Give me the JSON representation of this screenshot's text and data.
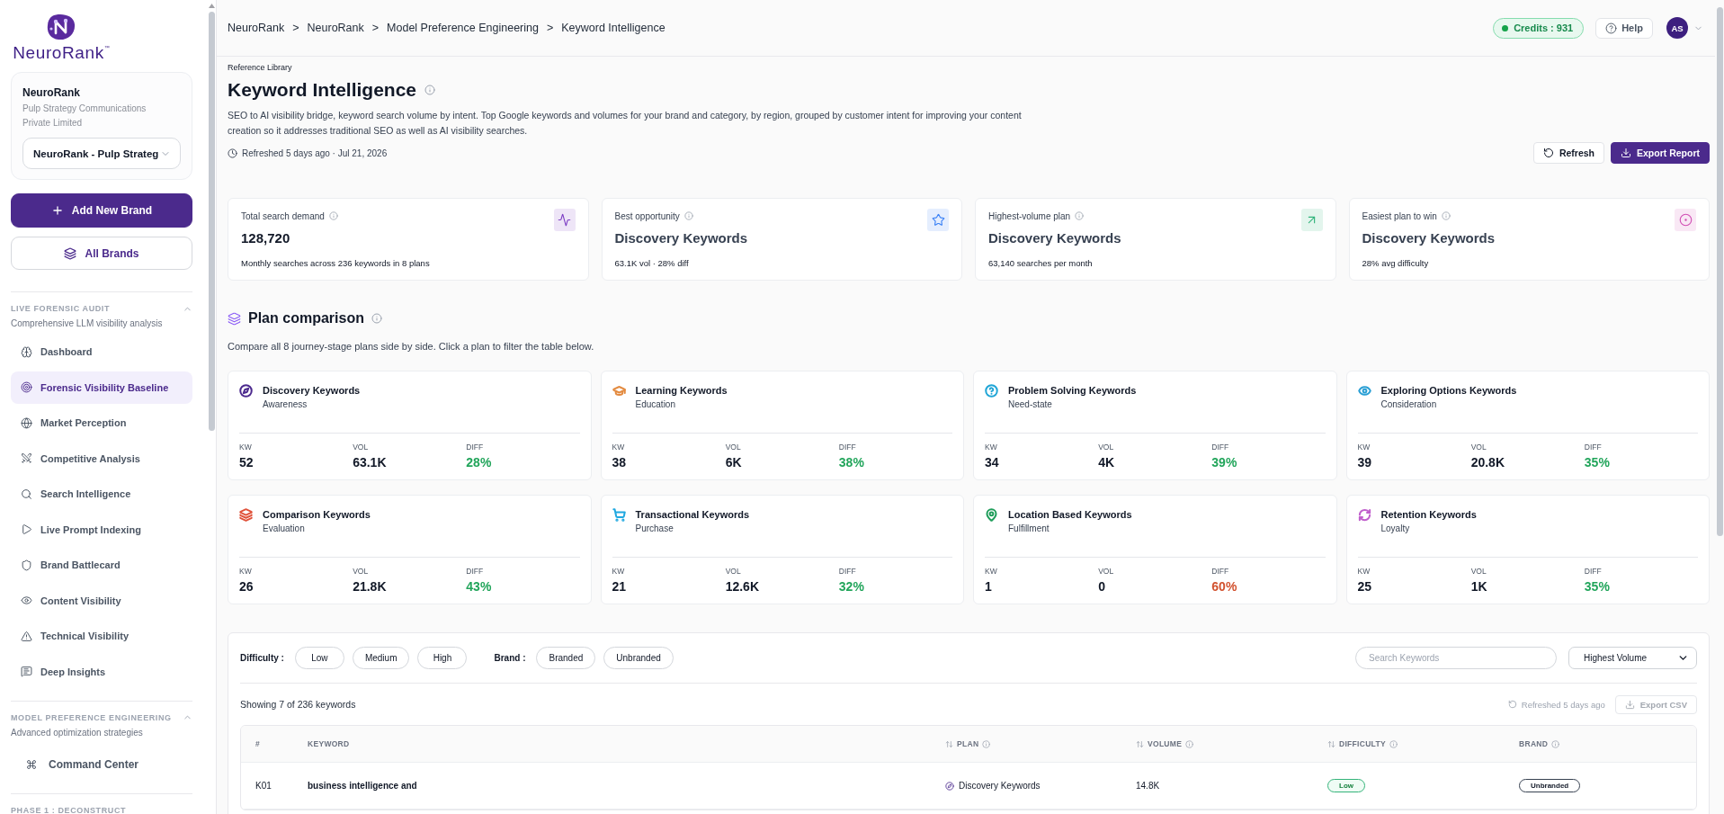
{
  "sidebar": {
    "logo": "NeuroRank$^{™}$",
    "brand": {
      "name": "NeuroRank",
      "company": "Pulp Strategy Communications Private Limited",
      "selector": "NeuroRank - Pulp Strateg"
    },
    "actions": [
      {
        "label": "Add New Brand",
        "kind": "primary"
      },
      {
        "label": "All Brands",
        "kind": "secondary"
      }
    ],
    "sections": [
      {
        "title": "LIVE FORENSIC AUDIT",
        "subtitle": "Comprehensive LLM visibility analysis",
        "expanded": true,
        "items": [
          {
            "label": "Dashboard",
            "selected": false,
            "kind": "page"
          },
          {
            "label": "Forensic Visibility Baseline",
            "selected": true,
            "kind": "page"
          },
          {
            "label": "Market Perception",
            "selected": false,
            "kind": "page"
          },
          {
            "label": "Competitive Analysis",
            "selected": false,
            "kind": "page"
          },
          {
            "label": "Search Intelligence",
            "selected": false,
            "kind": "page"
          },
          {
            "label": "Live Prompt Indexing",
            "selected": false,
            "kind": "page"
          },
          {
            "label": "Brand Battlecard",
            "selected": false,
            "kind": "page"
          },
          {
            "label": "Content Visibility",
            "selected": false,
            "kind": "page"
          },
          {
            "label": "Technical Visibility",
            "selected": false,
            "kind": "page"
          },
          {
            "label": "Deep Insights",
            "selected": false,
            "kind": "page"
          }
        ]
      },
      {
        "title": "MODEL PREFERENCE ENGINEERING",
        "subtitle": "Advanced optimization strategies",
        "expanded": true,
        "items": [
          {
            "label": "Command Center",
            "selected": false,
            "kind": "command"
          }
        ]
      },
      {
        "title": "PHASE 1 : DECONSTRUCT"
      }
    ]
  },
  "header": {
    "breadcrumb": [
      "NeuroRank",
      "NeuroRank",
      "Model Preference Engineering",
      "Keyword Intelligence"
    ],
    "separator": ">",
    "credits": "Credits : 931",
    "help": "Help",
    "avatar": "AS"
  },
  "page": {
    "eyebrow": "Reference Library",
    "title": "Keyword Intelligence",
    "description": "SEO to AI visibility bridge, keyword search volume by intent. Top Google keywords and volumes for your brand and category, by region, grouped by customer intent for improving your content creation so it addresses traditional SEO as well as AI visibility searches.",
    "refreshed": "Refreshed 5 days ago · Jul 21, 2026",
    "buttons": [
      {
        "label": "Refresh",
        "kind": "secondary"
      },
      {
        "label": "Export Report",
        "kind": "primary"
      }
    ]
  },
  "stats": [
    {
      "label": "Total search demand",
      "value": "128,720",
      "note": "Monthly searches across 236 keywords in 8 plans",
      "color": "#7e3fc4"
    },
    {
      "label": "Best opportunity",
      "value": "Discovery Keywords",
      "note": "63.1K vol · 28% diff",
      "color": "#3b82f6"
    },
    {
      "label": "Highest-volume plan",
      "value": "Discovery Keywords",
      "note": "63,140 searches per month",
      "color": "#2fb37a"
    },
    {
      "label": "Easiest plan to win",
      "value": "Discovery Keywords",
      "note": "28% avg difficulty",
      "color": "#d14fb4"
    }
  ],
  "plan_comparison": {
    "title": "Plan comparison",
    "subtitle": "Compare all 8 journey-stage plans side by side. Click a plan to filter the table below.",
    "plans": [
      {
        "name": "Discovery Keywords",
        "stage": "Awareness",
        "color": "#4c2a8e",
        "metrics": [
          {
            "label": "KW",
            "value": "52",
            "kind": "count"
          },
          {
            "label": "VOL",
            "value": "63.1K",
            "kind": "count"
          },
          {
            "label": "DIFF",
            "value": "28%",
            "kind": "good"
          }
        ]
      },
      {
        "name": "Learning Keywords",
        "stage": "Education",
        "color": "#e38a3f",
        "metrics": [
          {
            "label": "KW",
            "value": "38",
            "kind": "count"
          },
          {
            "label": "VOL",
            "value": "6K",
            "kind": "count"
          },
          {
            "label": "DIFF",
            "value": "38%",
            "kind": "good"
          }
        ]
      },
      {
        "name": "Problem Solving Keywords",
        "stage": "Need-state",
        "color": "#1fa5d6",
        "metrics": [
          {
            "label": "KW",
            "value": "34",
            "kind": "count"
          },
          {
            "label": "VOL",
            "value": "4K",
            "kind": "count"
          },
          {
            "label": "DIFF",
            "value": "39%",
            "kind": "good"
          }
        ]
      },
      {
        "name": "Exploring Options Keywords",
        "stage": "Consideration",
        "color": "#2a9fd4",
        "metrics": [
          {
            "label": "KW",
            "value": "39",
            "kind": "count"
          },
          {
            "label": "VOL",
            "value": "20.8K",
            "kind": "count"
          },
          {
            "label": "DIFF",
            "value": "35%",
            "kind": "good"
          }
        ]
      },
      {
        "name": "Comparison Keywords",
        "stage": "Evaluation",
        "color": "#e0533c",
        "metrics": [
          {
            "label": "KW",
            "value": "26",
            "kind": "count"
          },
          {
            "label": "VOL",
            "value": "21.8K",
            "kind": "count"
          },
          {
            "label": "DIFF",
            "value": "43%",
            "kind": "good"
          }
        ]
      },
      {
        "name": "Transactional Keywords",
        "stage": "Purchase",
        "color": "#20a8e0",
        "metrics": [
          {
            "label": "KW",
            "value": "21",
            "kind": "count"
          },
          {
            "label": "VOL",
            "value": "12.6K",
            "kind": "count"
          },
          {
            "label": "DIFF",
            "value": "32%",
            "kind": "good"
          }
        ]
      },
      {
        "name": "Location Based Keywords",
        "stage": "Fulfillment",
        "color": "#1f9d5a",
        "metrics": [
          {
            "label": "KW",
            "value": "1",
            "kind": "count"
          },
          {
            "label": "VOL",
            "value": "0",
            "kind": "count"
          },
          {
            "label": "DIFF",
            "value": "60%",
            "kind": "warn"
          }
        ]
      },
      {
        "name": "Retention Keywords",
        "stage": "Loyalty",
        "color": "#c05fcc",
        "metrics": [
          {
            "label": "KW",
            "value": "25",
            "kind": "count"
          },
          {
            "label": "VOL",
            "value": "1K",
            "kind": "count"
          },
          {
            "label": "DIFF",
            "value": "35%",
            "kind": "good"
          }
        ]
      }
    ]
  },
  "filters": {
    "groups": [
      {
        "label": "Difficulty :",
        "options": [
          {
            "label": "Low",
            "selected": false
          },
          {
            "label": "Medium",
            "selected": false
          },
          {
            "label": "High",
            "selected": false
          }
        ]
      },
      {
        "label": "Brand :",
        "options": [
          {
            "label": "Branded",
            "selected": false
          },
          {
            "label": "Unbranded",
            "selected": false
          }
        ]
      }
    ],
    "search": {
      "placeholder": "Search Keywords"
    },
    "sort": {
      "value": "Highest Volume"
    }
  },
  "results": {
    "summary": "Showing 7 of 236 keywords",
    "refreshed": "Refreshed 5 days ago",
    "export": {
      "label": "Export CSV",
      "disabled": true
    }
  },
  "table": {
    "columns": [
      {
        "label": "#",
        "sortable": false,
        "info": false
      },
      {
        "label": "KEYWORD",
        "sortable": false,
        "info": false
      },
      {
        "label": "PLAN",
        "sortable": true,
        "info": true
      },
      {
        "label": "VOLUME",
        "sortable": true,
        "info": true
      },
      {
        "label": "DIFFICULTY",
        "sortable": true,
        "info": true
      },
      {
        "label": "BRAND",
        "sortable": false,
        "info": true
      }
    ],
    "rows": [
      {
        "id": "K01",
        "keyword": "business intelligence and",
        "plan": "Discovery Keywords",
        "volume": "14.8K",
        "difficulty": {
          "label": "Low",
          "kind": "low"
        },
        "brand": "Unbranded"
      }
    ]
  }
}
